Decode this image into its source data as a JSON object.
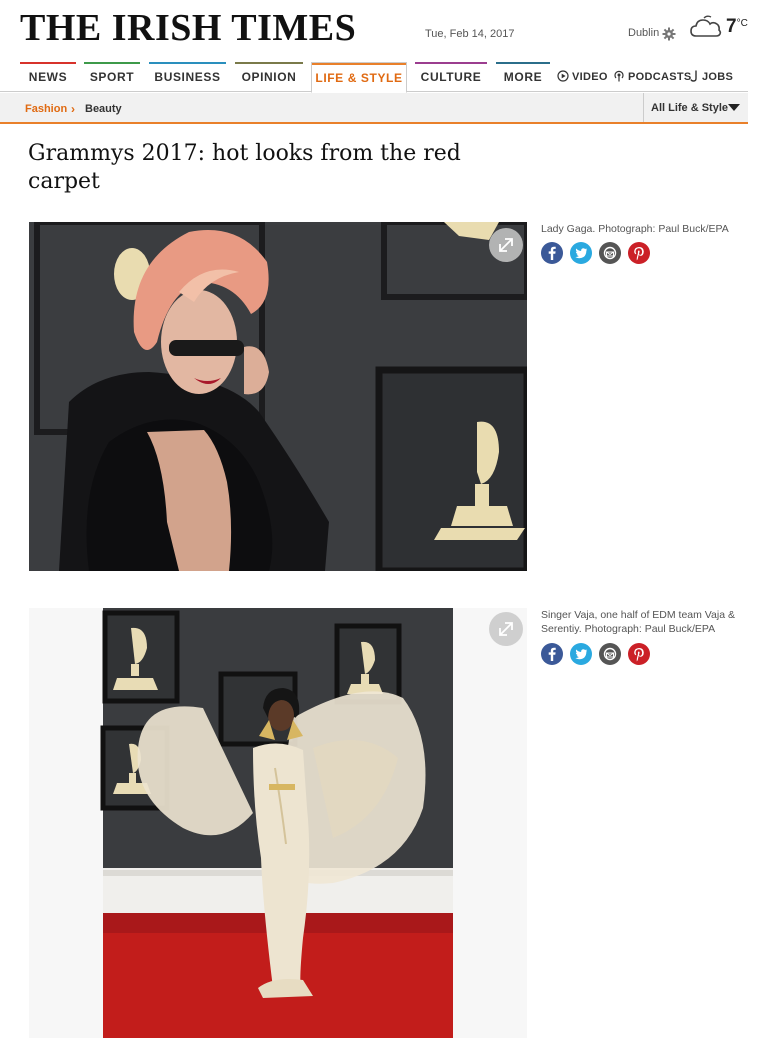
{
  "masthead": {
    "logo": "THE IRISH TIMES",
    "date": "Tue, Feb 14, 2017",
    "city": "Dublin",
    "temperature": "7",
    "temperature_unit": "°C",
    "weather_icon": "cloud-icon"
  },
  "nav": {
    "items": [
      {
        "label": "NEWS",
        "color": "#d7322b"
      },
      {
        "label": "SPORT",
        "color": "#3e9a4a"
      },
      {
        "label": "BUSINESS",
        "color": "#2a8fbd"
      },
      {
        "label": "OPINION",
        "color": "#7a7a4a"
      },
      {
        "label": "LIFE & STYLE",
        "color": "#e9802a",
        "active": true
      },
      {
        "label": "CULTURE",
        "color": "#9b3d8f"
      },
      {
        "label": "MORE",
        "color": "#2b6e8a"
      }
    ],
    "links": [
      {
        "label": "VIDEO",
        "icon": "play-circle-icon"
      },
      {
        "label": "PODCASTS",
        "icon": "podcast-icon"
      },
      {
        "label": "JOBS",
        "icon": "jobs-icon"
      }
    ]
  },
  "subnav": {
    "crumb_section": "Fashion",
    "crumb_separator": "›",
    "crumb_current": "Beauty",
    "all_section": "All Life & Style"
  },
  "article": {
    "headline": "Grammys 2017: hot looks from the red carpet",
    "accent_color": "#e06a12"
  },
  "gallery": [
    {
      "caption": "Lady Gaga. Photograph: Paul Buck/EPA",
      "expand_icon": "expand-icon",
      "shares": [
        "facebook-icon",
        "twitter-icon",
        "email-icon",
        "pinterest-icon"
      ]
    },
    {
      "caption": "Singer Vaja, one half of EDM team Vaja & Serentiy. Photograph: Paul Buck/EPA",
      "expand_icon": "expand-icon",
      "shares": [
        "facebook-icon",
        "twitter-icon",
        "email-icon",
        "pinterest-icon"
      ]
    }
  ]
}
